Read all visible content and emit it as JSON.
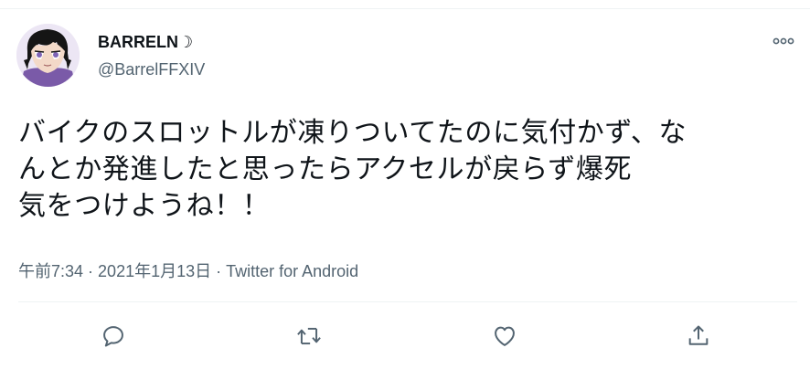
{
  "user": {
    "display_name": "BARRELN☽",
    "handle": "@BarrelFFXIV"
  },
  "tweet": {
    "lines": [
      "バイクのスロットルが凍りついてたのに気付かず、な",
      "んとか発進したと思ったらアクセルが戻らず爆死",
      "気をつけようね！！"
    ]
  },
  "meta": {
    "time": "午前7:34",
    "separator1": " · ",
    "date": "2021年1月13日",
    "separator2": " · ",
    "source": "Twitter for Android"
  },
  "icons": {
    "more": "more-horizontal-icon",
    "reply": "reply-icon",
    "retweet": "retweet-icon",
    "like": "heart-icon",
    "share": "share-icon"
  },
  "colors": {
    "text": "#0f1419",
    "secondary": "#536471",
    "divider": "#eff3f4"
  }
}
